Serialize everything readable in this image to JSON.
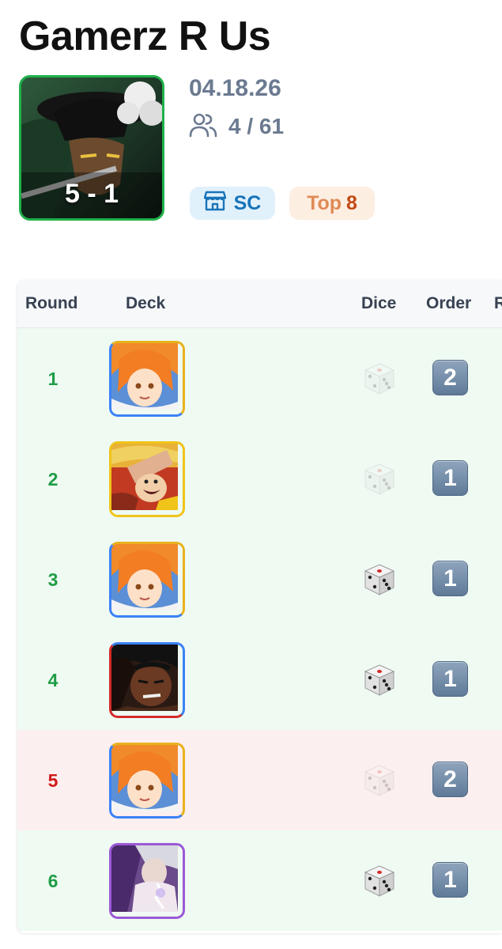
{
  "event": {
    "title": "Gamerz R Us",
    "date": "04.18.26",
    "record": "5 - 1",
    "players": "4 / 61",
    "badges": {
      "store": "SC",
      "placement_word": "Top",
      "placement_num": "8"
    }
  },
  "icons": {
    "players": "users-icon",
    "store": "store-icon",
    "dice": "dice-icon"
  },
  "colors": {
    "win_text": "#1f9d45",
    "loss_text": "#d11a1a",
    "win_row_bg": "#effaf3",
    "loss_row_bg": "#fcefef",
    "store_badge_text": "#1974b8",
    "placement_badge_text": "#c24a15"
  },
  "table": {
    "headers": [
      "Round",
      "Deck",
      "Dice",
      "Order",
      "R"
    ],
    "rows": [
      {
        "round": "1",
        "result": "win",
        "deck": "orange-hair-leader",
        "deck_border": "blue-yellow",
        "dice_won": false,
        "order": "2"
      },
      {
        "round": "2",
        "result": "win",
        "deck": "straw-hat-leader",
        "deck_border": "yellow",
        "dice_won": false,
        "order": "1"
      },
      {
        "round": "3",
        "result": "win",
        "deck": "orange-hair-leader",
        "deck_border": "blue-yellow",
        "dice_won": true,
        "order": "1"
      },
      {
        "round": "4",
        "result": "win",
        "deck": "dark-hair-leader",
        "deck_border": "blue-red",
        "dice_won": true,
        "order": "1"
      },
      {
        "round": "5",
        "result": "loss",
        "deck": "orange-hair-leader",
        "deck_border": "blue-yellow",
        "dice_won": false,
        "order": "2"
      },
      {
        "round": "6",
        "result": "win",
        "deck": "white-hair-leader",
        "deck_border": "purple",
        "dice_won": true,
        "order": "1"
      }
    ]
  }
}
